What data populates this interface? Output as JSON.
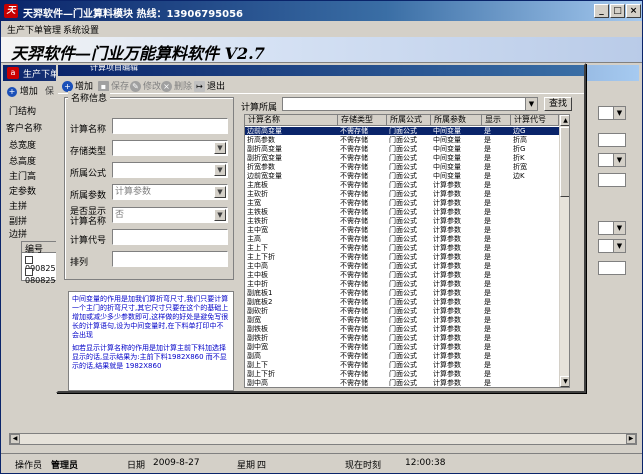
{
  "app": {
    "title": "天羿软件—门业算料模块   热线：13906795056",
    "banner": "天羿软件—门业万能算料软件 V2.7",
    "menu": [
      "生产下单管理",
      "系统设置"
    ]
  },
  "child": {
    "title": "生产下单",
    "toolbar": [
      "增加",
      "保"
    ],
    "labels": [
      "门结构",
      "客户名称",
      "总宽度",
      "总高度",
      "主门高",
      "定参数",
      "主拼",
      "副拼",
      "边拼"
    ],
    "table_header": "编号",
    "table_rows": [
      "090825",
      "080825"
    ]
  },
  "dialog": {
    "title": "计算项目编辑",
    "toolbar": [
      {
        "label": "增加",
        "icon": "plus-icon",
        "enabled": true
      },
      {
        "label": "保存",
        "icon": "save-icon",
        "enabled": false
      },
      {
        "label": "修改",
        "icon": "edit-icon",
        "enabled": false
      },
      {
        "label": "删除",
        "icon": "delete-icon",
        "enabled": false
      },
      {
        "label": "退出",
        "icon": "exit-icon",
        "enabled": true
      }
    ],
    "group_title": "名称信息",
    "fields": {
      "name": "计算名称",
      "storage": "存储类型",
      "formula": "所属公式",
      "param": "所属参数",
      "param_placeholder": "计算参数",
      "show": "是否显示\n计算名称",
      "show_value": "否",
      "code": "计算代号",
      "order": "排列"
    },
    "note": [
      "中间变量的作用是加我们算折弯尺寸,我们只要计算一个主门的折弯尺寸,其它尺寸只要在这个的基础上增加或减少多少参数即可,这样做的好处是避免写很长的计算语句,设为中间变量时,在下料单打印中不会出现",
      "如若显示计算名称的作用是加计算主前下料加选择显示的话,显示结果为:主前下料1982X860 而不显示的话,结果就是 1982X860"
    ],
    "search_label": "计算所属",
    "search_button": "查找",
    "columns": [
      "计算名称",
      "存储类型",
      "所属公式",
      "所属参数",
      "显示",
      "计算代号"
    ],
    "rows": [
      [
        "边前高变量",
        "不需存储",
        "门面公式",
        "中间变量",
        "是",
        "边G"
      ],
      [
        "折高参数",
        "不需存储",
        "门面公式",
        "中间变量",
        "是",
        "折高"
      ],
      [
        "副折高变量",
        "不需存储",
        "门面公式",
        "中间变量",
        "是",
        "折G"
      ],
      [
        "副折宽变量",
        "不需存储",
        "门面公式",
        "中间变量",
        "是",
        "折K"
      ],
      [
        "折宽参数",
        "不需存储",
        "门面公式",
        "中间变量",
        "是",
        "折宽"
      ],
      [
        "边前宽变量",
        "不需存储",
        "门面公式",
        "中间变量",
        "是",
        "边K"
      ],
      [
        "主底板",
        "不需存储",
        "门面公式",
        "计算参数",
        "是",
        ""
      ],
      [
        "主砍折",
        "不需存储",
        "门面公式",
        "计算参数",
        "是",
        ""
      ],
      [
        "主宽",
        "不需存储",
        "门面公式",
        "计算参数",
        "是",
        ""
      ],
      [
        "主铁板",
        "不需存储",
        "门面公式",
        "计算参数",
        "是",
        ""
      ],
      [
        "主铁折",
        "不需存储",
        "门面公式",
        "计算参数",
        "是",
        ""
      ],
      [
        "主中宽",
        "不需存储",
        "门面公式",
        "计算参数",
        "是",
        ""
      ],
      [
        "主高",
        "不需存储",
        "门面公式",
        "计算参数",
        "是",
        ""
      ],
      [
        "主上下",
        "不需存储",
        "门面公式",
        "计算参数",
        "是",
        ""
      ],
      [
        "主上下折",
        "不需存储",
        "门面公式",
        "计算参数",
        "是",
        ""
      ],
      [
        "主中高",
        "不需存储",
        "门面公式",
        "计算参数",
        "是",
        ""
      ],
      [
        "主中板",
        "不需存储",
        "门面公式",
        "计算参数",
        "是",
        ""
      ],
      [
        "主中折",
        "不需存储",
        "门面公式",
        "计算参数",
        "是",
        ""
      ],
      [
        "副底板1",
        "不需存储",
        "门面公式",
        "计算参数",
        "是",
        ""
      ],
      [
        "副底板2",
        "不需存储",
        "门面公式",
        "计算参数",
        "是",
        ""
      ],
      [
        "副砍折",
        "不需存储",
        "门面公式",
        "计算参数",
        "是",
        ""
      ],
      [
        "副宽",
        "不需存储",
        "门面公式",
        "计算参数",
        "是",
        ""
      ],
      [
        "副铁板",
        "不需存储",
        "门面公式",
        "计算参数",
        "是",
        ""
      ],
      [
        "副铁折",
        "不需存储",
        "门面公式",
        "计算参数",
        "是",
        ""
      ],
      [
        "副中宽",
        "不需存储",
        "门面公式",
        "计算参数",
        "是",
        ""
      ],
      [
        "副高",
        "不需存储",
        "门面公式",
        "计算参数",
        "是",
        ""
      ],
      [
        "副上下",
        "不需存储",
        "门面公式",
        "计算参数",
        "是",
        ""
      ],
      [
        "副上下折",
        "不需存储",
        "门面公式",
        "计算参数",
        "是",
        ""
      ],
      [
        "副中高",
        "不需存储",
        "门面公式",
        "计算参数",
        "是",
        ""
      ]
    ]
  },
  "status": {
    "operator_label": "操作员",
    "operator": "管理员",
    "date_label": "日期",
    "date": "2009-8-27",
    "weekday_label": "星期",
    "weekday": "四",
    "time_label": "现在时刻",
    "time": "12:00:38"
  }
}
